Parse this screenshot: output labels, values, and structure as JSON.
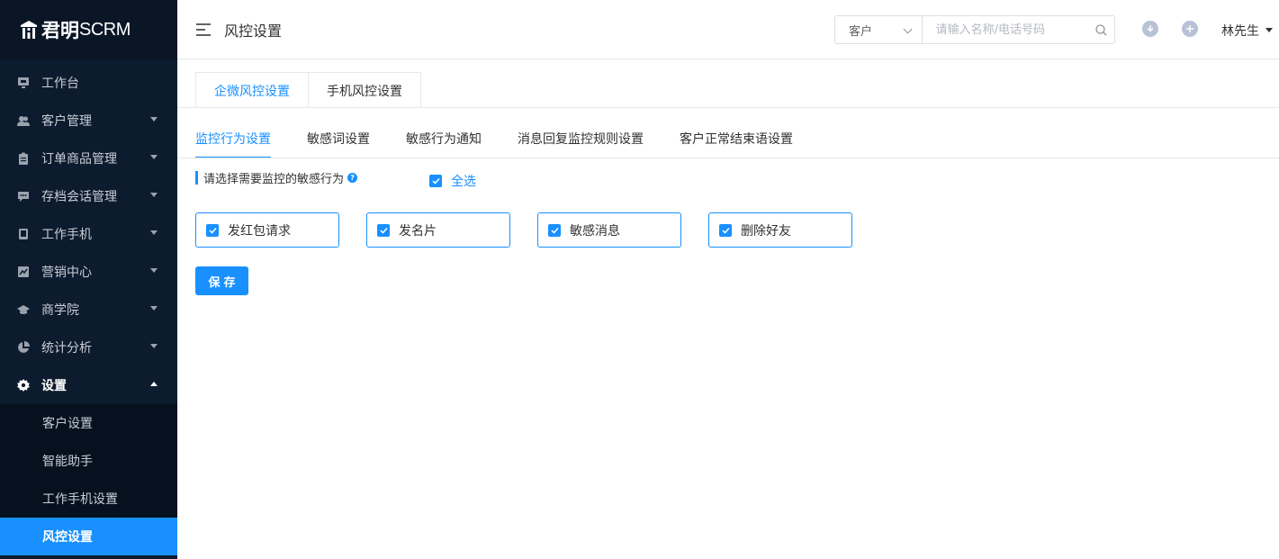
{
  "app": {
    "logo_text": "君明",
    "logo_suffix": "SCRM"
  },
  "sidebar": {
    "items": [
      {
        "label": "工作台",
        "icon": "monitor-icon"
      },
      {
        "label": "客户管理",
        "icon": "users-icon"
      },
      {
        "label": "订单商品管理",
        "icon": "clipboard-icon"
      },
      {
        "label": "存档会话管理",
        "icon": "chat-icon"
      },
      {
        "label": "工作手机",
        "icon": "phone-icon"
      },
      {
        "label": "营销中心",
        "icon": "chart-icon"
      },
      {
        "label": "商学院",
        "icon": "graduation-cap-icon"
      },
      {
        "label": "统计分析",
        "icon": "pie-chart-icon"
      },
      {
        "label": "设置",
        "icon": "gear-icon"
      }
    ],
    "settings_submenu": [
      {
        "label": "客户设置"
      },
      {
        "label": "智能助手"
      },
      {
        "label": "工作手机设置"
      },
      {
        "label": "风控设置"
      }
    ]
  },
  "header": {
    "page_title": "风控设置",
    "search_scope": "客户",
    "search_placeholder": "请输入名称/电话号码",
    "user_name": "林先生"
  },
  "card_tabs": [
    {
      "label": "企微风控设置"
    },
    {
      "label": "手机风控设置"
    }
  ],
  "sub_tabs": [
    {
      "label": "监控行为设置"
    },
    {
      "label": "敏感词设置"
    },
    {
      "label": "敏感行为通知"
    },
    {
      "label": "消息回复监控规则设置"
    },
    {
      "label": "客户正常结束语设置"
    }
  ],
  "monitor": {
    "section_label": "请选择需要监控的敏感行为",
    "help_glyph": "?",
    "select_all_label": "全选",
    "select_all_checked": true,
    "options": [
      {
        "label": "发红包请求",
        "checked": true
      },
      {
        "label": "发名片",
        "checked": true
      },
      {
        "label": "敏感消息",
        "checked": true
      },
      {
        "label": "删除好友",
        "checked": true
      }
    ],
    "save_label": "保存"
  },
  "colors": {
    "accent": "#1890ff",
    "sidebar_bg": "#0d1b2e"
  }
}
